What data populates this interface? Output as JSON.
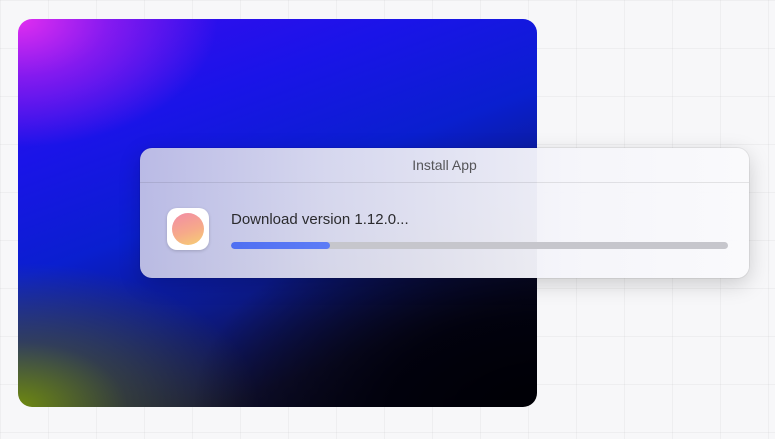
{
  "dialog": {
    "title": "Install App",
    "status_text": "Download version 1.12.0...",
    "progress_percent": 20,
    "app_icon": "app-icon"
  },
  "colors": {
    "progress_fill": "#4f6ff2",
    "progress_track": "#c6c6cc",
    "title_text": "#555558",
    "status_text": "#2b2b2e"
  }
}
